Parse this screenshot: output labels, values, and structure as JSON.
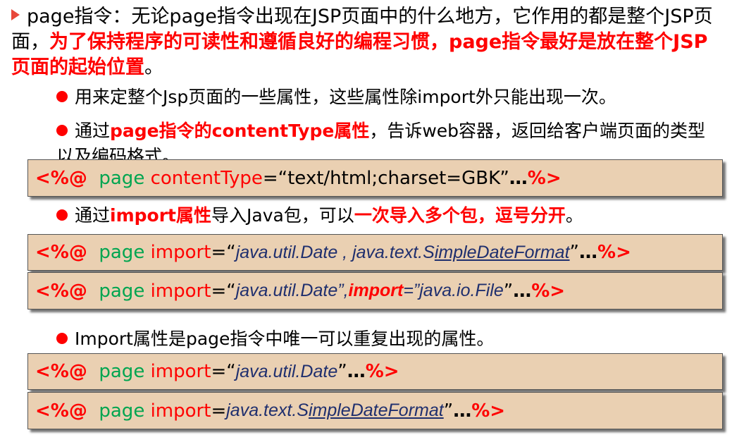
{
  "main_para": {
    "t1": "page指令：无论page指令出现在JSP页面中的什么地方，它作用的都是整个JSP页面，",
    "t2": "为了保持程序的可读性和遵循良好的编程习惯，page指令最好是放在整个JSP页面的起始位置",
    "t3": "。"
  },
  "bullet1": {
    "text": "用来定整个Jsp页面的一些属性，这些属性除import外只能出现一次。"
  },
  "bullet2": {
    "t1": "通过",
    "t2": "page指令的contentType属性",
    "t3": "，告诉web容器，返回给客户端页面的类型以及编码格式。"
  },
  "code1": {
    "open": "<%@",
    "page": "page",
    "attr": "contentType",
    "eq": "=",
    "val": "“text/html;charset=GBK”",
    "dots": " … ",
    "close": "%>"
  },
  "bullet3": {
    "t1": "通过",
    "t2": "import属性",
    "t3": "导入Java包，可以",
    "t4": "一次导入多个包，逗号分开",
    "t5": "。"
  },
  "code2": {
    "open": "<%@",
    "page": "page",
    "attr": "import",
    "eq": "=",
    "q1": "“",
    "v1": "java.util.Date , java.text.S",
    "v2": "impleDateFormat",
    "q2": "”",
    "dots": " … ",
    "close": "%>"
  },
  "code3": {
    "open": "<%@",
    "page": "page",
    "attr": "import",
    "eq": "=",
    "q1": "“",
    "v1": "java.util.Date”",
    "comma": " , ",
    "attr2": "import",
    "v2": "=”java.io.File",
    "q2": "”",
    "dots": " … ",
    "close": "%>"
  },
  "bullet4": {
    "text": "Import属性是page指令中唯一可以重复出现的属性。"
  },
  "code4": {
    "open": "<%@",
    "page": "page",
    "attr": "import",
    "eq": "=",
    "q1": "“",
    "v1": "java.util.Date",
    "q2": "”",
    "dots": " … ",
    "close": "%>"
  },
  "code5": {
    "open": "<%@",
    "page": "page",
    "attr": "import",
    "eq": "=",
    "v1": "java.text.S",
    "v2": "impleDateFormat",
    "q2": "”",
    "dots": " … ",
    "close": "%>"
  },
  "colors": {
    "keyword_red": "#ff0000",
    "page_green": "#00a550",
    "code_box_bg": "#ead0b2",
    "italic_navy": "#1f2f6e"
  }
}
